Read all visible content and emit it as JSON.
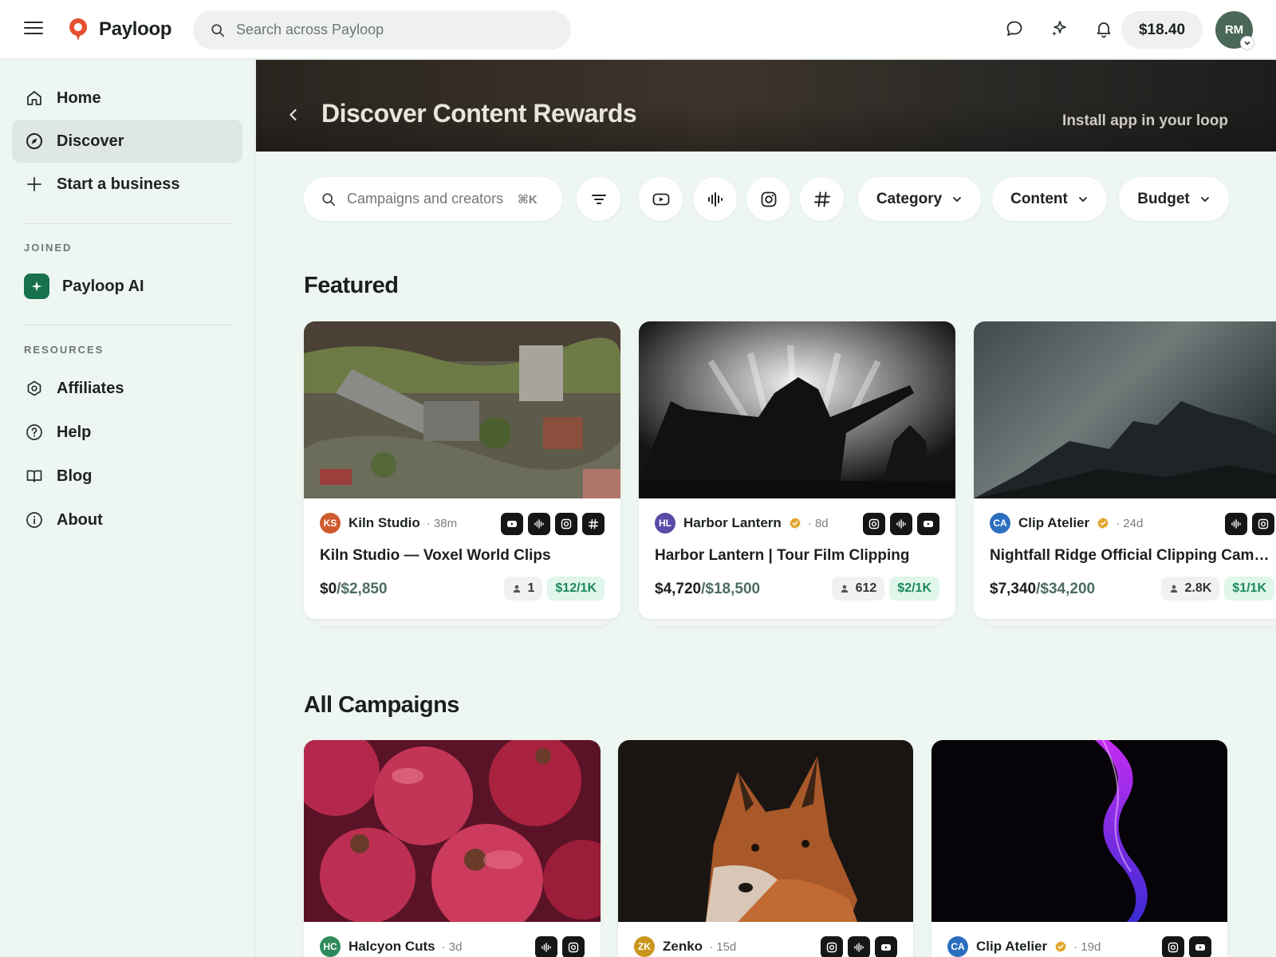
{
  "app": {
    "name": "Payloop",
    "brand_color": "#e5502f",
    "accent_green": "#17714f"
  },
  "topbar": {
    "search_placeholder": "Search across Payloop",
    "balance": "$18.40",
    "avatar_initials": "RM",
    "icons": [
      "menu-icon",
      "chat-icon",
      "sparkle-icon",
      "bell-icon"
    ]
  },
  "sidebar": {
    "items": [
      {
        "label": "Home",
        "icon": "home-icon"
      },
      {
        "label": "Discover",
        "icon": "compass-icon",
        "active": true
      },
      {
        "label": "Start a business",
        "icon": "plus-icon"
      }
    ],
    "joined_label": "JOINED",
    "joined": [
      {
        "label": "Payloop AI",
        "icon": "sparkle-icon"
      }
    ],
    "resources_label": "RESOURCES",
    "resources": [
      {
        "label": "Affiliates",
        "icon": "affiliate-icon"
      },
      {
        "label": "Help",
        "icon": "help-icon"
      },
      {
        "label": "Blog",
        "icon": "book-icon"
      },
      {
        "label": "About",
        "icon": "info-icon"
      }
    ]
  },
  "banner": {
    "title": "Discover Content Rewards",
    "install_label": "Install app in your loop"
  },
  "filters": {
    "search_placeholder": "Campaigns and creators",
    "shortcut": "⌘K",
    "platform_buttons": [
      "youtube-icon",
      "audio-icon",
      "instagram-icon",
      "hashtag-icon"
    ],
    "dropdowns": [
      "Category",
      "Content",
      "Budget"
    ]
  },
  "featured": {
    "title": "Featured",
    "cards": [
      {
        "creator": "Kiln Studio",
        "initials": "KS",
        "avatar_color": "#d05a2b",
        "verified": false,
        "age": "· 38m",
        "platforms": [
          "youtube",
          "audio",
          "instagram",
          "hashtag"
        ],
        "title": "Kiln Studio — Voxel World Clips",
        "paid": "$0",
        "budget": "/$2,850",
        "users": "1",
        "rate": "$12/1K"
      },
      {
        "creator": "Harbor Lantern",
        "initials": "HL",
        "avatar_color": "#5b4aa8",
        "verified": true,
        "age": "· 8d",
        "platforms": [
          "instagram",
          "audio",
          "youtube"
        ],
        "title": "Harbor Lantern | Tour Film Clipping",
        "paid": "$4,720",
        "budget": "/$18,500",
        "users": "612",
        "rate": "$2/1K"
      },
      {
        "creator": "Clip Atelier",
        "initials": "CA",
        "avatar_color": "#2c6fbf",
        "verified": true,
        "age": "· 24d",
        "platforms": [
          "audio",
          "instagram"
        ],
        "title": "Nightfall Ridge Official Clipping Campa...",
        "paid": "$7,340",
        "budget": "/$34,200",
        "users": "2.8K",
        "rate": "$1/1K"
      }
    ]
  },
  "all_campaigns": {
    "title": "All Campaigns",
    "cards": [
      {
        "creator": "Halcyon Cuts",
        "initials": "HC",
        "avatar_color": "#2f8a5c",
        "verified": false,
        "age": "· 3d",
        "platforms": [
          "audio",
          "instagram"
        ]
      },
      {
        "creator": "Zenko",
        "initials": "ZK",
        "avatar_color": "#c9961e",
        "verified": false,
        "age": "· 15d",
        "platforms": [
          "instagram",
          "audio",
          "youtube"
        ]
      },
      {
        "creator": "Clip Atelier",
        "initials": "CA",
        "avatar_color": "#2c6fbf",
        "verified": true,
        "age": "· 19d",
        "platforms": [
          "instagram",
          "youtube"
        ]
      }
    ]
  }
}
